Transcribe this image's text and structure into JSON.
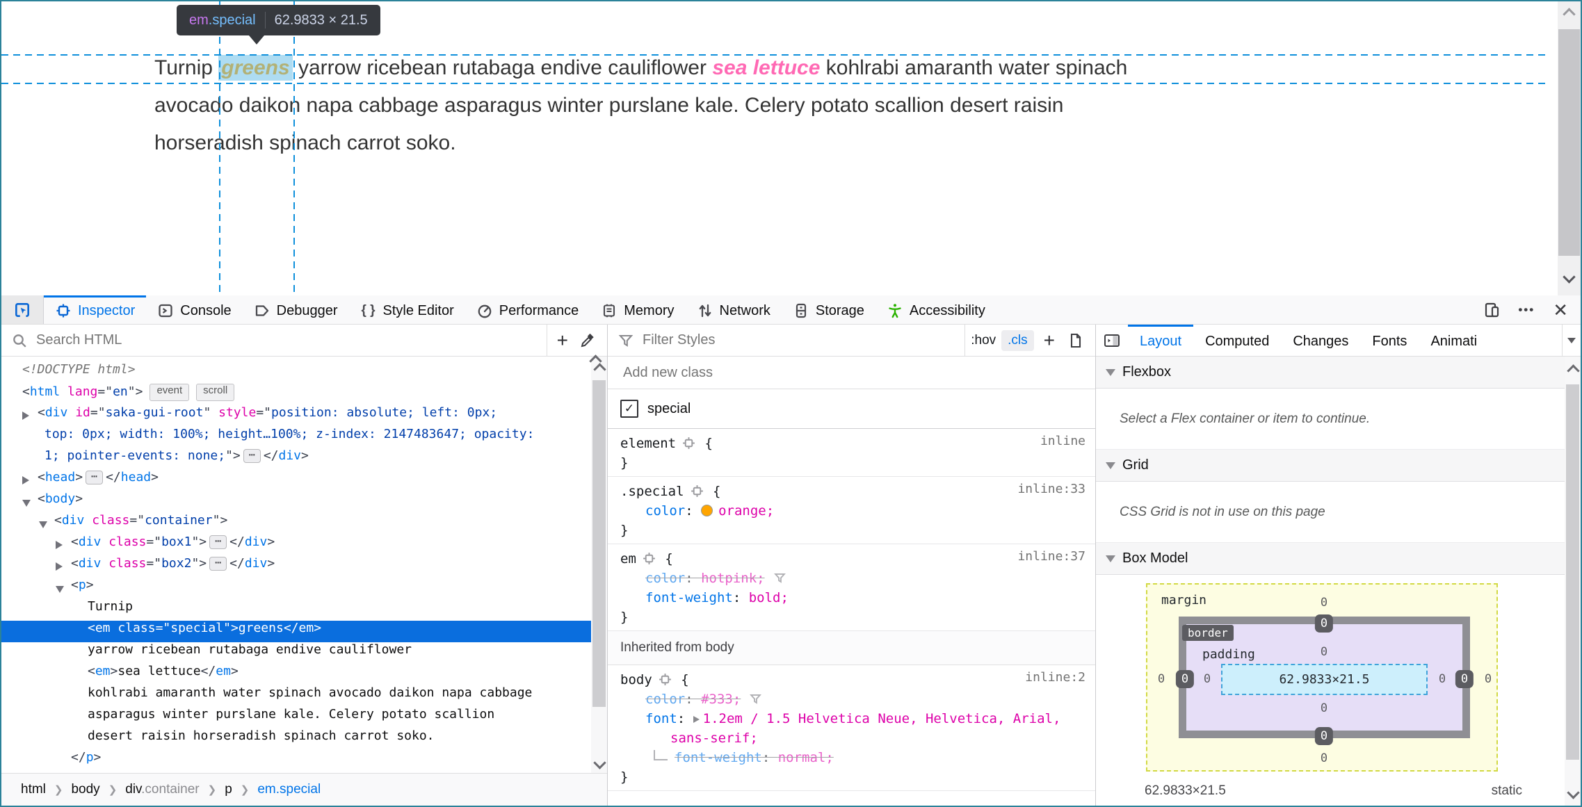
{
  "colors": {
    "accent": "#0074e8",
    "guide_blue": "#0e8fdb",
    "selection_blue": "#0a6ede",
    "highlight_fill": "#aedcf2",
    "hotpink": "#ff69b4",
    "orange_swatch": "#ffa500",
    "window_border_teal": "#2b8299",
    "accessibility_green": "#2bb200"
  },
  "tooltip": {
    "tag": "em",
    "class": ".special",
    "dims": "62.9833 × 21.5"
  },
  "page": {
    "line1_pre": "Turnip ",
    "em_special_text": "greens",
    "line1_mid": " yarrow ricebean rutabaga endive cauliflower ",
    "em_plain_text": "sea lettuce",
    "line1_post": " kohlrabi amaranth water spinach",
    "line2": "avocado daikon napa cabbage asparagus winter purslane kale. Celery potato scallion desert raisin",
    "line3": "horseradish spinach carrot soko."
  },
  "toolbar": {
    "tabs": [
      {
        "icon": "inspector",
        "label": "Inspector",
        "active": true
      },
      {
        "icon": "console",
        "label": "Console"
      },
      {
        "icon": "debugger",
        "label": "Debugger"
      },
      {
        "icon": "style-editor",
        "label": "Style Editor"
      },
      {
        "icon": "performance",
        "label": "Performance"
      },
      {
        "icon": "memory",
        "label": "Memory"
      },
      {
        "icon": "network",
        "label": "Network"
      },
      {
        "icon": "storage",
        "label": "Storage"
      },
      {
        "icon": "accessibility",
        "label": "Accessibility"
      }
    ]
  },
  "markup_panel": {
    "search_placeholder": "Search HTML",
    "rows": [
      {
        "indent": 30,
        "segs": [
          [
            "g",
            "<!DOCTYPE html>"
          ]
        ]
      },
      {
        "indent": 30,
        "segs": [
          [
            "p",
            "<"
          ],
          [
            "t",
            "html"
          ],
          [
            "a",
            " lang"
          ],
          [
            "p",
            "=\""
          ],
          [
            "v",
            "en"
          ],
          [
            "p",
            "\">"
          ]
        ],
        "badges": [
          "event",
          "scroll"
        ]
      },
      {
        "indent": 52,
        "arrow": "closed",
        "segs": [
          [
            "p",
            "<"
          ],
          [
            "t",
            "div"
          ],
          [
            "a",
            " id"
          ],
          [
            "p",
            "=\""
          ],
          [
            "v",
            "saka-gui-root"
          ],
          [
            "p",
            "\""
          ],
          [
            "a",
            " style"
          ],
          [
            "p",
            "=\""
          ],
          [
            "v",
            "position: absolute; left: 0px;"
          ]
        ]
      },
      {
        "indent": 62,
        "segs": [
          [
            "v",
            "top: 0px; width: 100%; height…100%; z-index: 2147483647; opacity:"
          ]
        ]
      },
      {
        "indent": 62,
        "segs": [
          [
            "v",
            "1; pointer-events: none;"
          ],
          [
            "p",
            "\">"
          ],
          [
            "e",
            "⋯"
          ],
          [
            "p",
            "</"
          ],
          [
            "t",
            "div"
          ],
          [
            "p",
            ">"
          ]
        ]
      },
      {
        "indent": 52,
        "arrow": "closed",
        "segs": [
          [
            "p",
            "<"
          ],
          [
            "t",
            "head"
          ],
          [
            "p",
            ">"
          ],
          [
            "e",
            "⋯"
          ],
          [
            "p",
            "</"
          ],
          [
            "t",
            "head"
          ],
          [
            "p",
            ">"
          ]
        ]
      },
      {
        "indent": 52,
        "arrow": "open",
        "segs": [
          [
            "p",
            "<"
          ],
          [
            "t",
            "body"
          ],
          [
            "p",
            ">"
          ]
        ]
      },
      {
        "indent": 76,
        "arrow": "open",
        "segs": [
          [
            "p",
            "<"
          ],
          [
            "t",
            "div"
          ],
          [
            "a",
            " class"
          ],
          [
            "p",
            "=\""
          ],
          [
            "v",
            "container"
          ],
          [
            "p",
            "\">"
          ]
        ]
      },
      {
        "indent": 100,
        "arrow": "closed",
        "segs": [
          [
            "p",
            "<"
          ],
          [
            "t",
            "div"
          ],
          [
            "a",
            " class"
          ],
          [
            "p",
            "=\""
          ],
          [
            "v",
            "box1"
          ],
          [
            "p",
            "\">"
          ],
          [
            "e",
            "⋯"
          ],
          [
            "p",
            "</"
          ],
          [
            "t",
            "div"
          ],
          [
            "p",
            ">"
          ]
        ]
      },
      {
        "indent": 100,
        "arrow": "closed",
        "segs": [
          [
            "p",
            "<"
          ],
          [
            "t",
            "div"
          ],
          [
            "a",
            " class"
          ],
          [
            "p",
            "=\""
          ],
          [
            "v",
            "box2"
          ],
          [
            "p",
            "\">"
          ],
          [
            "e",
            "⋯"
          ],
          [
            "p",
            "</"
          ],
          [
            "t",
            "div"
          ],
          [
            "p",
            ">"
          ]
        ]
      },
      {
        "indent": 100,
        "arrow": "open",
        "segs": [
          [
            "p",
            "<"
          ],
          [
            "t",
            "p"
          ],
          [
            "p",
            ">"
          ]
        ]
      },
      {
        "indent": 124,
        "segs": [
          [
            "x",
            "Turnip"
          ]
        ]
      },
      {
        "indent": 124,
        "selected": true,
        "segs": [
          [
            "p",
            "<"
          ],
          [
            "t",
            "em"
          ],
          [
            "a",
            " class"
          ],
          [
            "p",
            "=\""
          ],
          [
            "v",
            "special"
          ],
          [
            "p",
            "\">"
          ],
          [
            "x",
            "greens"
          ],
          [
            "p",
            "</"
          ],
          [
            "t",
            "em"
          ],
          [
            "p",
            ">"
          ]
        ]
      },
      {
        "indent": 124,
        "segs": [
          [
            "x",
            "yarrow ricebean rutabaga endive cauliflower"
          ]
        ]
      },
      {
        "indent": 124,
        "segs": [
          [
            "p",
            "<"
          ],
          [
            "t",
            "em"
          ],
          [
            "p",
            ">"
          ],
          [
            "x",
            "sea lettuce"
          ],
          [
            "p",
            "</"
          ],
          [
            "t",
            "em"
          ],
          [
            "p",
            ">"
          ]
        ]
      },
      {
        "indent": 124,
        "segs": [
          [
            "x",
            "kohlrabi amaranth water spinach avocado daikon napa cabbage"
          ]
        ]
      },
      {
        "indent": 124,
        "segs": [
          [
            "x",
            "asparagus winter purslane kale. Celery potato scallion"
          ]
        ]
      },
      {
        "indent": 124,
        "segs": [
          [
            "x",
            "desert raisin horseradish spinach carrot soko."
          ]
        ]
      },
      {
        "indent": 100,
        "segs": [
          [
            "p",
            "</"
          ],
          [
            "t",
            "p"
          ],
          [
            "p",
            ">"
          ]
        ]
      }
    ]
  },
  "breadcrumb": {
    "items": [
      {
        "main": "html"
      },
      {
        "main": "body"
      },
      {
        "main": "div",
        "sub": ".container"
      },
      {
        "main": "p"
      },
      {
        "main": "em.special",
        "active": true
      }
    ]
  },
  "rules_panel": {
    "filter_placeholder": "Filter Styles",
    "pseudo_toggle": ":hov",
    "class_toggle": ".cls",
    "add_class_placeholder": "Add new class",
    "class_checkbox": {
      "checked": true,
      "label": "special"
    },
    "rules": [
      {
        "selector": "element",
        "loc": "inline",
        "decls": []
      },
      {
        "selector": ".special",
        "loc": "inline:33",
        "decls": [
          {
            "name": "color",
            "value": "orange",
            "swatch": "#ffa500"
          }
        ]
      },
      {
        "selector": "em",
        "loc": "inline:37",
        "decls": [
          {
            "name": "color",
            "value": "hotpink",
            "struck": true,
            "funnel": true
          },
          {
            "name": "font-weight",
            "value": "bold"
          }
        ]
      }
    ],
    "inherited_header": "Inherited from body",
    "inherited_rules": [
      {
        "selector": "body",
        "loc": "inline:2",
        "decls": [
          {
            "name": "color",
            "value": "#333",
            "struck": true,
            "funnel": true
          },
          {
            "name": "font",
            "value": "1.2em / 1.5 Helvetica Neue, Helvetica, Arial,",
            "value_wrap": "sans-serif;",
            "expandable": true,
            "sub": [
              {
                "name": "font-weight",
                "value": "normal",
                "struck": true
              }
            ]
          }
        ]
      }
    ]
  },
  "layout_panel": {
    "tabs": [
      {
        "label": "Layout",
        "active": true
      },
      {
        "label": "Computed"
      },
      {
        "label": "Changes"
      },
      {
        "label": "Fonts"
      },
      {
        "label": "Animati"
      }
    ],
    "sections": {
      "flexbox": {
        "title": "Flexbox",
        "message": "Select a Flex container or item to continue."
      },
      "grid": {
        "title": "Grid",
        "message": "CSS Grid is not in use on this page"
      },
      "box_model": {
        "title": "Box Model"
      }
    },
    "box_model": {
      "margin_label": "margin",
      "border_label": "border",
      "padding_label": "padding",
      "content": "62.9833×21.5",
      "margin": {
        "top": "0",
        "right": "0",
        "bottom": "0",
        "left": "0"
      },
      "border": {
        "top": "0",
        "right": "0",
        "bottom": "0",
        "left": "0"
      },
      "padding": {
        "top": "0",
        "right": "0",
        "bottom": "0",
        "left": "0"
      },
      "footer_dims": "62.9833×21.5",
      "footer_position": "static"
    }
  }
}
